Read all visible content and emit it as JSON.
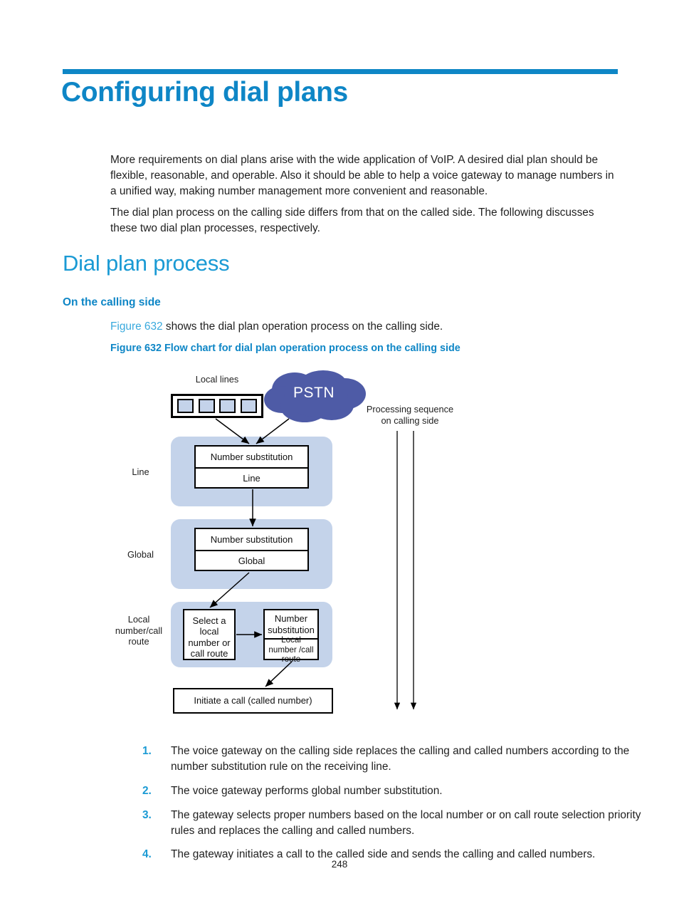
{
  "document": {
    "chapter_title": "Configuring dial plans",
    "page_number": "248"
  },
  "body": {
    "paragraph_1": "More requirements on dial plans arise with the wide application of VoIP. A desired dial plan should be flexible, reasonable, and operable. Also it should be able to help a voice gateway to manage numbers in a unified way, making number management more convenient and reasonable.",
    "paragraph_2": "The dial plan process on the calling side differs from that on the called side. The following discusses these two dial plan processes, respectively."
  },
  "sections": {
    "h1": "Dial plan process",
    "h2": "On the calling side",
    "xref_link": "Figure 632",
    "xref_rest": " shows the dial plan operation process on the calling side.",
    "figure_caption": "Figure 632 Flow chart for dial plan operation process on the calling side"
  },
  "figure": {
    "local_lines_label": "Local lines",
    "cloud_label": "PSTN",
    "processing_sequence_label_line1": "Processing sequence",
    "processing_sequence_label_line2": "on calling side",
    "stage_labels": {
      "line": "Line",
      "global": "Global",
      "local": "Local\nnumber/call\nroute"
    },
    "boxes": {
      "line_top": "Number substitution",
      "line_bottom": "Line",
      "global_top": "Number substitution",
      "global_bottom": "Global",
      "select": "Select a local number or call route",
      "numsub_top": "Number substitution",
      "numsub_bottom": "Local number /call route",
      "initiate": "Initiate a call (called number)"
    }
  },
  "steps": [
    {
      "marker": "1.",
      "text": "The voice gateway on the calling side replaces the calling and called numbers according to the number substitution rule on the receiving line."
    },
    {
      "marker": "2.",
      "text": "The voice gateway performs global number substitution."
    },
    {
      "marker": "3.",
      "text": "The gateway selects proper numbers based on the local number or on call route selection priority rules and replaces the calling and called numbers."
    },
    {
      "marker": "4.",
      "text": "The gateway initiates a call to the called side and sends the calling and called numbers."
    }
  ],
  "colors": {
    "accent_blue": "#0e86c6",
    "heading_blue": "#1a9ad4",
    "cloud_blue": "#4e5ba6",
    "band_blue": "#c4d3ea"
  }
}
